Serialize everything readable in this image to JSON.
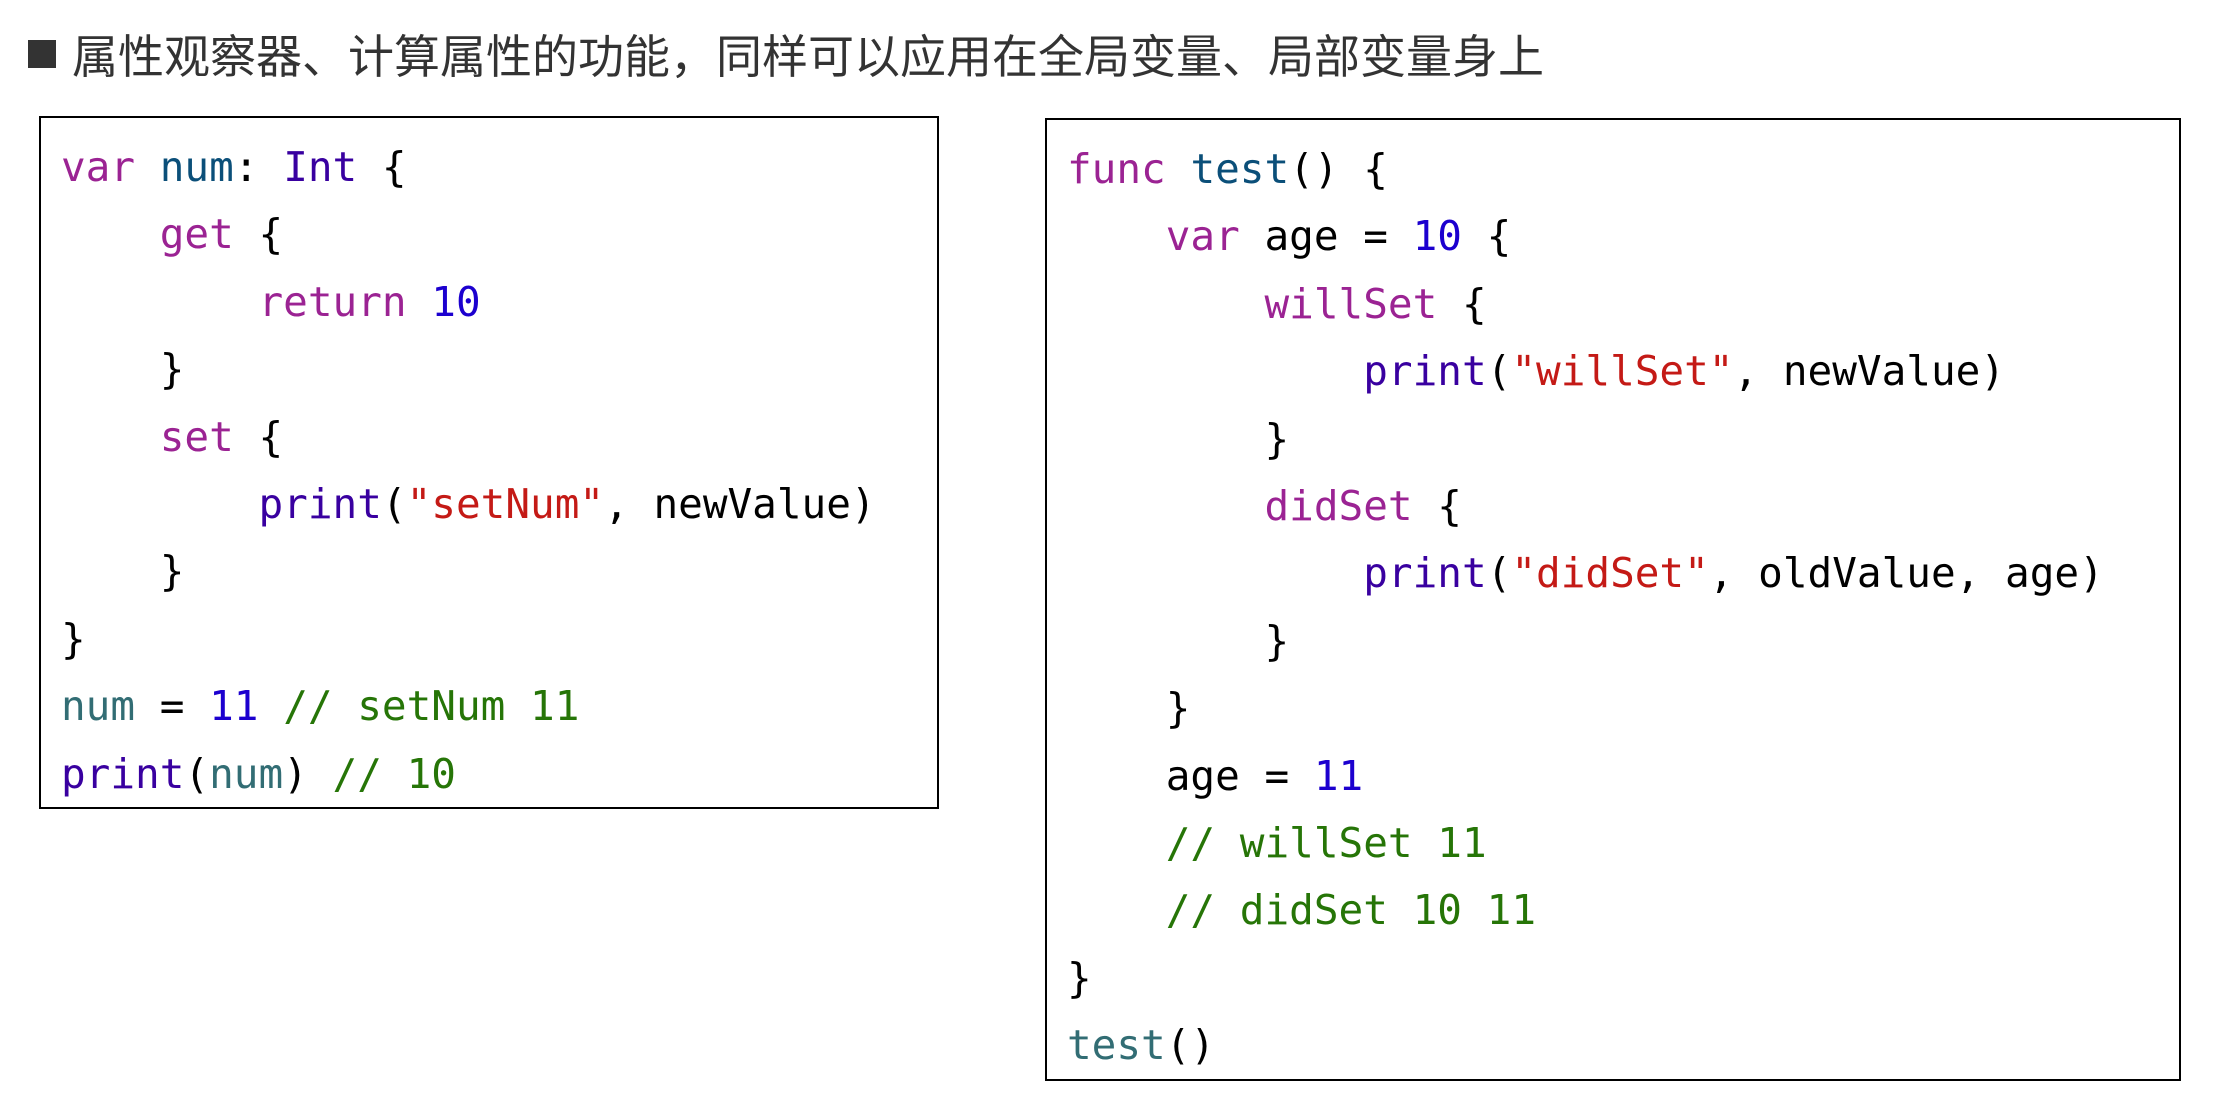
{
  "heading": {
    "text": "属性观察器、计算属性的功能，同样可以应用在全局变量、局部变量身上"
  },
  "left_code": [
    [
      [
        "kw",
        "var"
      ],
      [
        "txt",
        " "
      ],
      [
        "fn",
        "num"
      ],
      [
        "txt",
        ": "
      ],
      [
        "type",
        "Int"
      ],
      [
        "txt",
        " {"
      ]
    ],
    [
      [
        "txt",
        "    "
      ],
      [
        "kw",
        "get"
      ],
      [
        "txt",
        " {"
      ]
    ],
    [
      [
        "txt",
        "        "
      ],
      [
        "kw",
        "return"
      ],
      [
        "txt",
        " "
      ],
      [
        "num",
        "10"
      ]
    ],
    [
      [
        "txt",
        "    }"
      ]
    ],
    [
      [
        "txt",
        "    "
      ],
      [
        "kw",
        "set"
      ],
      [
        "txt",
        " {"
      ]
    ],
    [
      [
        "txt",
        "        "
      ],
      [
        "call",
        "print"
      ],
      [
        "txt",
        "("
      ],
      [
        "str",
        "\"setNum\""
      ],
      [
        "txt",
        ", newValue)"
      ]
    ],
    [
      [
        "txt",
        "    }"
      ]
    ],
    [
      [
        "txt",
        "}"
      ]
    ],
    [
      [
        "id",
        "num"
      ],
      [
        "txt",
        " = "
      ],
      [
        "num",
        "11"
      ],
      [
        "txt",
        " "
      ],
      [
        "cm",
        "// setNum 11"
      ]
    ],
    [
      [
        "call",
        "print"
      ],
      [
        "txt",
        "("
      ],
      [
        "id",
        "num"
      ],
      [
        "txt",
        ") "
      ],
      [
        "cm",
        "// 10"
      ]
    ]
  ],
  "right_code": [
    [
      [
        "kw",
        "func"
      ],
      [
        "txt",
        " "
      ],
      [
        "fn",
        "test"
      ],
      [
        "txt",
        "() {"
      ]
    ],
    [
      [
        "txt",
        "    "
      ],
      [
        "kw",
        "var"
      ],
      [
        "txt",
        " age = "
      ],
      [
        "num",
        "10"
      ],
      [
        "txt",
        " {"
      ]
    ],
    [
      [
        "txt",
        "        "
      ],
      [
        "kw",
        "willSet"
      ],
      [
        "txt",
        " {"
      ]
    ],
    [
      [
        "txt",
        "            "
      ],
      [
        "call",
        "print"
      ],
      [
        "txt",
        "("
      ],
      [
        "str",
        "\"willSet\""
      ],
      [
        "txt",
        ", newValue)"
      ]
    ],
    [
      [
        "txt",
        "        }"
      ]
    ],
    [
      [
        "txt",
        "        "
      ],
      [
        "kw",
        "didSet"
      ],
      [
        "txt",
        " {"
      ]
    ],
    [
      [
        "txt",
        "            "
      ],
      [
        "call",
        "print"
      ],
      [
        "txt",
        "("
      ],
      [
        "str",
        "\"didSet\""
      ],
      [
        "txt",
        ", oldValue, age)"
      ]
    ],
    [
      [
        "txt",
        "        }"
      ]
    ],
    [
      [
        "txt",
        "    }"
      ]
    ],
    [
      [
        "txt",
        "    age = "
      ],
      [
        "num",
        "11"
      ]
    ],
    [
      [
        "txt",
        "    "
      ],
      [
        "cm",
        "// willSet 11"
      ]
    ],
    [
      [
        "txt",
        "    "
      ],
      [
        "cm",
        "// didSet 10 11"
      ]
    ],
    [
      [
        "txt",
        "}"
      ]
    ],
    [
      [
        "id",
        "test"
      ],
      [
        "txt",
        "()"
      ]
    ]
  ]
}
